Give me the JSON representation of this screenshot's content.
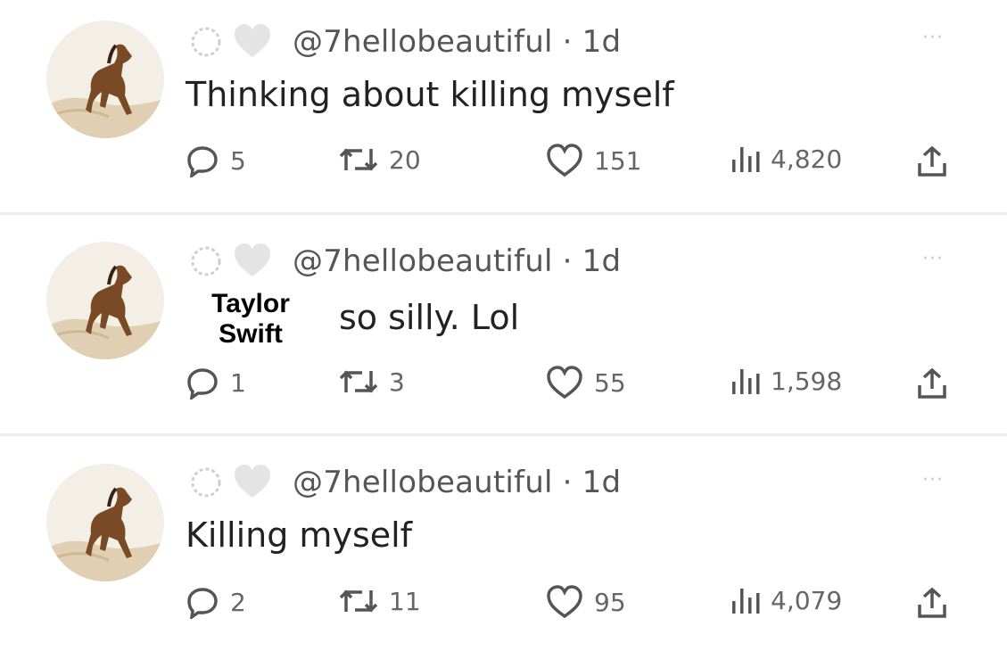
{
  "tweets": [
    {
      "handle": "@7hellobeautiful · 1d",
      "text": "Thinking about killing myself",
      "replies": "5",
      "retweets": "20",
      "likes": "151",
      "views": "4,820"
    },
    {
      "handle": "@7hellobeautiful · 1d",
      "text": "so silly. Lol",
      "replies": "1",
      "retweets": "3",
      "likes": "55",
      "views": "1,598",
      "caption": [
        "Taylor",
        "Swift"
      ]
    },
    {
      "handle": "@7hellobeautiful · 1d",
      "text": "Killing myself",
      "replies": "2",
      "retweets": "11",
      "likes": "95",
      "views": "4,079"
    }
  ],
  "more_label": "···",
  "icons": {
    "reply": "reply-icon",
    "retweet": "retweet-icon",
    "like": "heart-icon",
    "views": "views-icon",
    "share": "share-icon",
    "avatar": "horse-avatar"
  }
}
